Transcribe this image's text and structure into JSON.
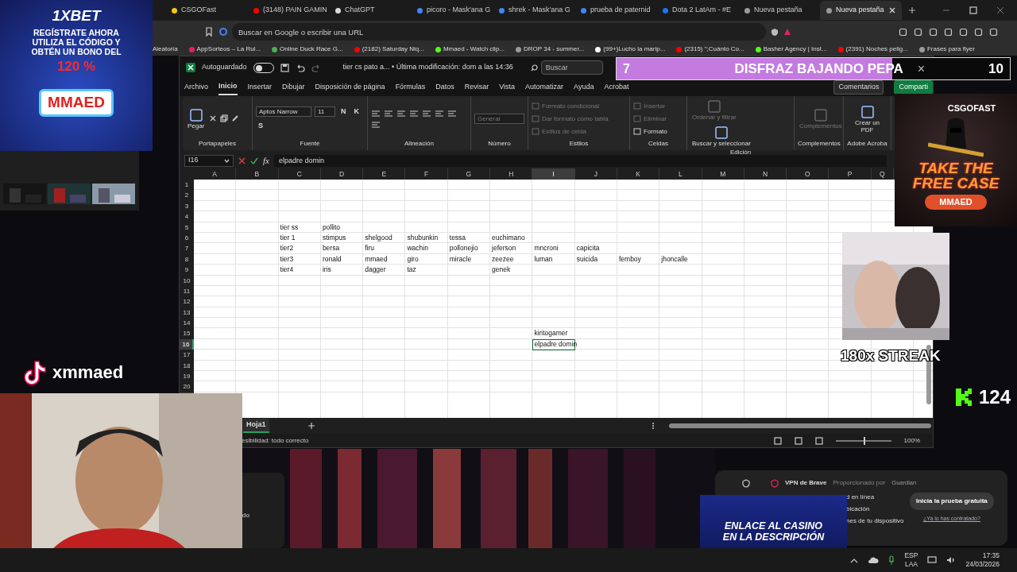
{
  "browser": {
    "tabs": [
      {
        "label": "CSGOFast",
        "color": "#f5c518",
        "selected": false
      },
      {
        "label": "(3148) PAIN GAMIN",
        "color": "#ff0000",
        "selected": false
      },
      {
        "label": "ChatGPT",
        "color": "#d9d9d9",
        "selected": false
      },
      {
        "label": "picoro - Mask'ana G",
        "color": "#4285f4",
        "selected": false
      },
      {
        "label": "shrek - Mask'ana G",
        "color": "#4285f4",
        "selected": false
      },
      {
        "label": "prueba de paternid",
        "color": "#4285f4",
        "selected": false
      },
      {
        "label": "Dota 2 LatAm - #E",
        "color": "#1877f2",
        "selected": false
      },
      {
        "label": "Nueva pestaña",
        "color": "#9a9a9a",
        "selected": false
      },
      {
        "label": "Nueva pestaña",
        "color": "#9a9a9a",
        "selected": true
      }
    ],
    "address_placeholder": "Buscar en Google o escribir una URL",
    "bookmarks": [
      {
        "label": "Aleatoria"
      },
      {
        "label": "AppSorteos – La Rul...",
        "color": "#e91e63"
      },
      {
        "label": "Online Duck Race G...",
        "color": "#4caf50"
      },
      {
        "label": "(2182) Saturday Niq...",
        "color": "#ff0000"
      },
      {
        "label": "Mmaed - Watch clip...",
        "color": "#53fc18"
      },
      {
        "label": "DROP 34 - summer...",
        "color": "#9a9a9a"
      },
      {
        "label": "(99+)Lucho la marip...",
        "color": "#ffffff"
      },
      {
        "label": "(2315) \";Cuánto Co...",
        "color": "#ff0000"
      },
      {
        "label": "Basher Agency | Inst...",
        "color": "#53fc18"
      },
      {
        "label": "(2391) Noches pelig...",
        "color": "#ff0000"
      },
      {
        "label": "Frases para flyer",
        "color": "#9a9a9a"
      }
    ]
  },
  "excel": {
    "autosave": {
      "label": "Autoguardado",
      "on": false
    },
    "file_title": "tier cs pato a... • Última modificación: dom a las 14:36",
    "search_placeholder": "Buscar",
    "menu": [
      {
        "label": "Archivo",
        "selected": false
      },
      {
        "label": "Inicio",
        "selected": true
      },
      {
        "label": "Insertar",
        "selected": false
      },
      {
        "label": "Dibujar",
        "selected": false
      },
      {
        "label": "Disposición de página",
        "selected": false
      },
      {
        "label": "Fórmulas",
        "selected": false
      },
      {
        "label": "Datos",
        "selected": false
      },
      {
        "label": "Revisar",
        "selected": false
      },
      {
        "label": "Vista",
        "selected": false
      },
      {
        "label": "Automatizar",
        "selected": false
      },
      {
        "label": "Ayuda",
        "selected": false
      },
      {
        "label": "Acrobat",
        "selected": false
      }
    ],
    "comments_button": "Comentarios",
    "share_button": "Comparti",
    "ribbon_groups": [
      {
        "label": "Portapapeles",
        "items": [
          {
            "label": "Pegar",
            "kind": "big",
            "disabled": false
          }
        ]
      },
      {
        "label": "Fuente",
        "items": [
          {
            "label": "Aptos Narrow",
            "kind": "select",
            "disabled": false
          },
          {
            "label": "11",
            "kind": "select",
            "disabled": false
          },
          {
            "label": "N",
            "kind": "format",
            "disabled": false
          },
          {
            "label": "K",
            "kind": "format",
            "disabled": false
          },
          {
            "label": "S",
            "kind": "format",
            "disabled": false
          }
        ]
      },
      {
        "label": "Alineación",
        "items": [
          {
            "kind": "align"
          }
        ]
      },
      {
        "label": "Número",
        "items": [
          {
            "label": "General",
            "kind": "select",
            "disabled": true
          }
        ]
      },
      {
        "label": "Estilos",
        "items": [
          {
            "label": "Formato condicional",
            "kind": "small",
            "disabled": true
          },
          {
            "label": "Dar formato como tabla",
            "kind": "small",
            "disabled": true
          },
          {
            "label": "Estilos de celda",
            "kind": "small",
            "disabled": true
          }
        ]
      },
      {
        "label": "Celdas",
        "items": [
          {
            "label": "Insertar",
            "kind": "small",
            "disabled": true
          },
          {
            "label": "Eliminar",
            "kind": "small",
            "disabled": true
          },
          {
            "label": "Formato",
            "kind": "small",
            "disabled": false
          }
        ]
      },
      {
        "label": "Edición",
        "items": [
          {
            "label": "Ordenar y filtrar",
            "kind": "big",
            "disabled": true
          },
          {
            "label": "Buscar y seleccionar",
            "kind": "big",
            "disabled": false
          }
        ]
      },
      {
        "label": "Complementos",
        "items": [
          {
            "label": "Complementos",
            "kind": "big",
            "disabled": true
          }
        ]
      },
      {
        "label": "Adobe Acroba",
        "items": [
          {
            "label": "Crear un PDF",
            "kind": "big",
            "disabled": false
          }
        ]
      }
    ],
    "name_box": "I16",
    "fx_label": "fx",
    "formula": "elpadre domin",
    "columns": [
      {
        "label": "A",
        "selected": false
      },
      {
        "label": "B",
        "selected": false
      },
      {
        "label": "C",
        "selected": false
      },
      {
        "label": "D",
        "selected": false
      },
      {
        "label": "E",
        "selected": false
      },
      {
        "label": "F",
        "selected": false
      },
      {
        "label": "G",
        "selected": false
      },
      {
        "label": "H",
        "selected": false
      },
      {
        "label": "I",
        "selected": true
      },
      {
        "label": "J",
        "selected": false
      },
      {
        "label": "K",
        "selected": false
      },
      {
        "label": "L",
        "selected": false
      },
      {
        "label": "M",
        "selected": false
      },
      {
        "label": "N",
        "selected": false
      },
      {
        "label": "O",
        "selected": false
      },
      {
        "label": "P",
        "selected": false
      },
      {
        "label": "Q",
        "selected": false
      }
    ],
    "rows": [
      {
        "label": "1",
        "selected": false
      },
      {
        "label": "2",
        "selected": false
      },
      {
        "label": "3",
        "selected": false
      },
      {
        "label": "4",
        "selected": false
      },
      {
        "label": "5",
        "selected": false,
        "cells": [
          null,
          null,
          "tier ss",
          "pollito"
        ]
      },
      {
        "label": "6",
        "selected": false,
        "cells": [
          null,
          null,
          "tier 1",
          "stimpus",
          "shelgood",
          "shubunkin",
          "tessa",
          "euchimano"
        ]
      },
      {
        "label": "7",
        "selected": false,
        "cells": [
          null,
          null,
          "tier2",
          "bersa",
          "firu",
          "wachin",
          "pollonejio",
          "jeferson",
          "mncroni",
          "capicita"
        ]
      },
      {
        "label": "8",
        "selected": false,
        "cells": [
          null,
          null,
          "tier3",
          "ronald",
          "mmaed",
          "giro",
          "miracle",
          "zeezee",
          "luman",
          "suicida",
          "femboy",
          "jhoncalle"
        ]
      },
      {
        "label": "9",
        "selected": false,
        "cells": [
          null,
          null,
          "tier4",
          "iris",
          "dagger",
          "taz",
          null,
          "genek"
        ]
      },
      {
        "label": "10",
        "selected": false
      },
      {
        "label": "11",
        "selected": false
      },
      {
        "label": "12",
        "selected": false
      },
      {
        "label": "13",
        "selected": false
      },
      {
        "label": "14",
        "selected": false
      },
      {
        "label": "15",
        "selected": false,
        "cells": [
          null,
          null,
          null,
          null,
          null,
          null,
          null,
          null,
          "kiritogamer"
        ]
      },
      {
        "label": "16",
        "selected": true,
        "cells": [
          null,
          null,
          null,
          null,
          null,
          null,
          null,
          null,
          "elpadre domin"
        ]
      },
      {
        "label": "17",
        "selected": false
      },
      {
        "label": "18",
        "selected": false
      },
      {
        "label": "19",
        "selected": false
      },
      {
        "label": "20",
        "selected": false
      }
    ],
    "sheets": [
      {
        "label": "Hoja1",
        "selected": true
      }
    ],
    "status": "esibilidad: todo correcto",
    "zoom": {
      "level": 0.5,
      "reading": "100%"
    }
  },
  "overlays": {
    "bet_ad": {
      "brand": "1XBET",
      "headline": "REGÍSTRATE AHORA UTILIZA EL CÓDIGO Y OBTÉN UN BONO DEL",
      "bonus": "120 %",
      "code": "MMAED"
    },
    "tiktok_handle": "xmmaed",
    "goal_bar": {
      "count": "7",
      "title": "DISFRAZ BAJANDO PEPA",
      "close": "×",
      "target": "10",
      "level": 0.7
    },
    "case_ad": {
      "brand": "CSGOFAST",
      "tagline": "TAKE THE FREE CASE",
      "code": "MMAED"
    },
    "streak": "180x STREAK",
    "kick_count": "124",
    "desktop_fragment": "do",
    "vpn": {
      "title": "VPN de Brave",
      "provider": "Proporcionado por",
      "partner": "Guardian",
      "lines": [
        "d en línea",
        "bicación",
        "nes de tu dispositivo"
      ],
      "button": "Inicia la prueba gratuita",
      "link": "¿Ya lo has contratado?"
    },
    "casino_ad": "ENLACE AL CASINO EN LA DESCRIPCIÓN"
  },
  "taskbar": {
    "language": "ESP",
    "layout": "LAA",
    "time": "17:35",
    "date": "24/03/2026"
  }
}
